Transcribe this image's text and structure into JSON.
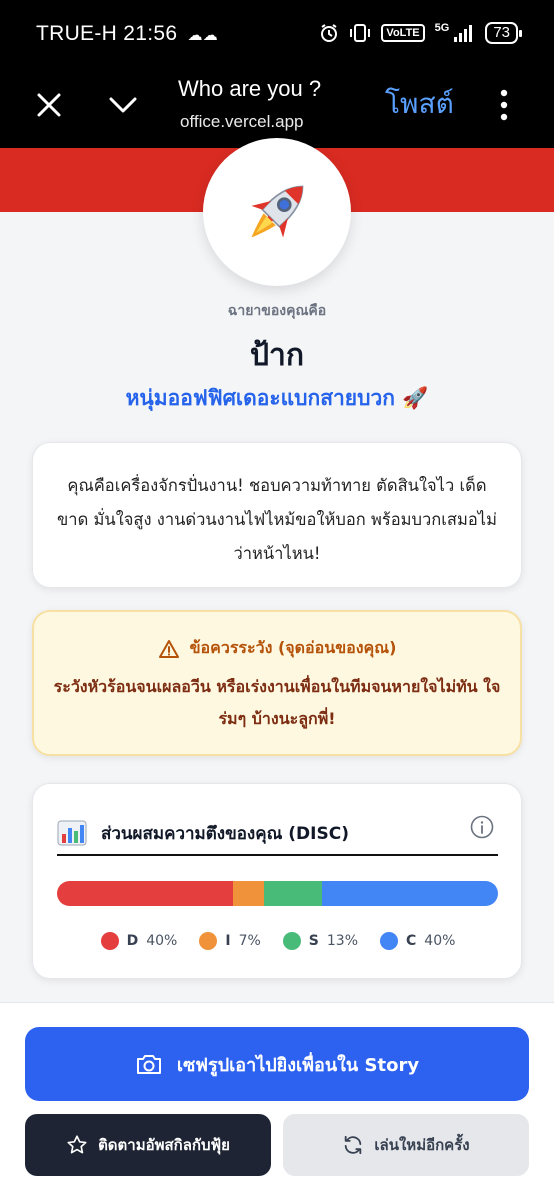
{
  "status_bar": {
    "carrier": "TRUE-H",
    "time": "21:56",
    "volte": "VoLTE",
    "network": "5G",
    "battery": "73"
  },
  "browser": {
    "title": "Who are you ?",
    "url": "office.vercel.app",
    "post_label": "โพสต์"
  },
  "result": {
    "label": "ฉายาของคุณคือ",
    "name": "ป้าก",
    "subtitle": "หนุ่มออฟฟิศเดอะแบกสายบวก 🚀",
    "description": "คุณคือเครื่องจักรปั่นงาน! ชอบความท้าทาย ตัดสินใจไว เด็ดขาด มั่นใจสูง งานด่วนงานไฟไหม้ขอให้บอก พร้อมบวกเสมอไม่ว่าหน้าไหน!"
  },
  "warning": {
    "title": "ข้อควรระวัง (จุดอ่อนของคุณ)",
    "body": "ระวังหัวร้อนจนเผลอวีน หรือเร่งงานเพื่อนในทีมจนหายใจไม่ทัน ใจร่มๆ บ้างนะลูกพี่!"
  },
  "disc": {
    "title": "ส่วนผสมความตึงของคุณ (DISC)"
  },
  "chart_data": {
    "type": "bar",
    "stacked": true,
    "categories": [
      "D",
      "I",
      "S",
      "C"
    ],
    "values": [
      40,
      7,
      13,
      40
    ],
    "value_labels": [
      "40%",
      "7%",
      "13%",
      "40%"
    ],
    "colors": [
      "#e53e3e",
      "#f0923a",
      "#48bb78",
      "#4285f4"
    ]
  },
  "actions": {
    "save_label": "เซฟรูปเอาไปยิงเพื่อนใน Story",
    "follow_label": "ติดตามอัพสกิลกับฟุ้ย",
    "replay_label": "เล่นใหม่อีกครั้ง"
  }
}
